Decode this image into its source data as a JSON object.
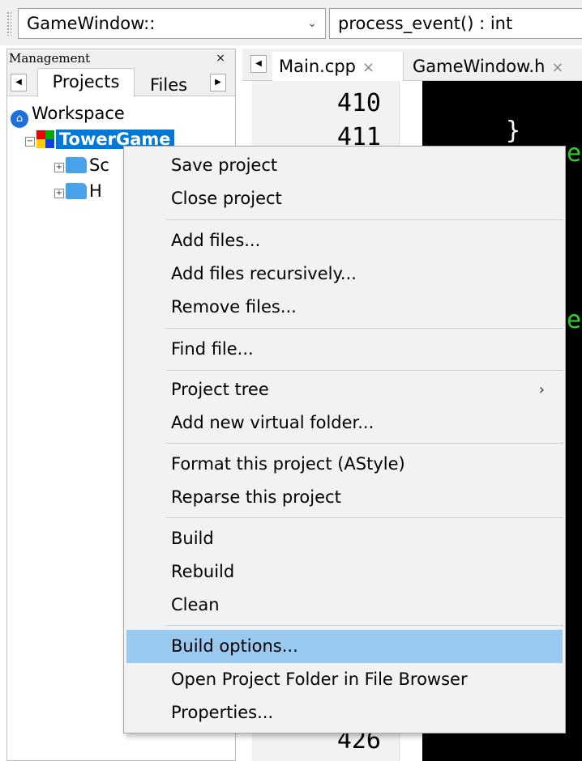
{
  "toolbar": {
    "scope_combo": "GameWindow::",
    "function_combo": "process_event() : int"
  },
  "management": {
    "title": "Management",
    "close_glyph": "×",
    "tabs": [
      {
        "label": "Projects",
        "active": true
      },
      {
        "label": "Files",
        "active": false
      }
    ],
    "tree": {
      "workspace_label": "Workspace",
      "project_label": "TowerGame",
      "folders": [
        {
          "label": "Sc"
        },
        {
          "label": "H"
        }
      ]
    }
  },
  "editor": {
    "tabs": [
      {
        "label": "Main.cpp",
        "close": "×"
      },
      {
        "label": "GameWindow.h",
        "close": "×"
      }
    ],
    "line_numbers": {
      "first": "410",
      "second": "411",
      "last": "426"
    },
    "code_fragments": {
      "brace": "}",
      "e1": "e",
      "e2": "e"
    }
  },
  "context_menu": {
    "items": [
      {
        "label": "Save project"
      },
      {
        "label": "Close project"
      },
      {
        "label": "Add files..."
      },
      {
        "label": "Add files recursively..."
      },
      {
        "label": "Remove files..."
      },
      {
        "label": "Find file..."
      },
      {
        "label": "Project tree",
        "submenu_glyph": "›"
      },
      {
        "label": "Add new virtual folder..."
      },
      {
        "label": "Format this project (AStyle)"
      },
      {
        "label": "Reparse this project"
      },
      {
        "label": "Build"
      },
      {
        "label": "Rebuild"
      },
      {
        "label": "Clean"
      },
      {
        "label": "Build options...",
        "selected": true
      },
      {
        "label": "Open Project Folder in File Browser"
      },
      {
        "label": "Properties..."
      }
    ]
  },
  "colors": {
    "selection": "#99c9ef",
    "tree_highlight": "#0078d7",
    "code_text": "#2bd92b"
  }
}
